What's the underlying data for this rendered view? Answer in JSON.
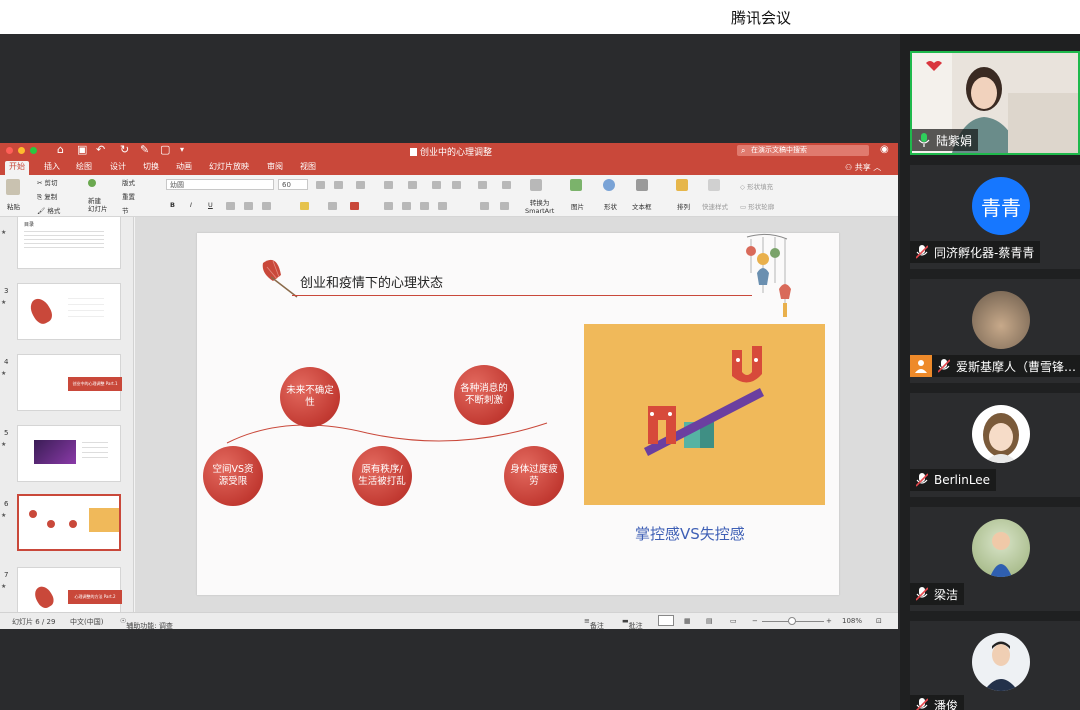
{
  "meeting": {
    "title": "腾讯会议"
  },
  "ppt": {
    "doc_title": "创业中的心理调整",
    "search_placeholder": "在演示文稿中搜索",
    "share_label": "共享",
    "tabs": [
      "开始",
      "插入",
      "绘图",
      "设计",
      "切换",
      "动画",
      "幻灯片放映",
      "审阅",
      "视图"
    ],
    "active_tab": "开始",
    "ribbon": {
      "paste": "粘贴",
      "cut": "剪切",
      "copy": "复制",
      "format": "格式",
      "new_slide": "新建\n幻灯片",
      "layout": "版式",
      "reset": "重置",
      "section": "节",
      "font_name": "幼圆",
      "font_size": "60",
      "convert_smartart": "转换为\nSmartArt",
      "picture": "图片",
      "shape": "形状",
      "textbox": "文本框",
      "arrange": "排列",
      "quick_styles": "快速样式",
      "shape_fill": "形状填充",
      "shape_outline": "形状轮廓"
    },
    "thumbnails": [
      {
        "num": "",
        "caption": "目录"
      },
      {
        "num": "3",
        "caption": ""
      },
      {
        "num": "4",
        "caption": "创业中的心理调整 Part.1"
      },
      {
        "num": "5",
        "caption": ""
      },
      {
        "num": "6",
        "caption": ""
      },
      {
        "num": "7",
        "caption": "心理调整的方法 Part.2"
      }
    ],
    "slide": {
      "title": "创业和疫情下的心理状态",
      "circles": [
        "未来不确定性",
        "各种消息的不断刺激",
        "空间VS资源受限",
        "原有秩序/生活被打乱",
        "身体过度疲劳"
      ],
      "caption": "掌控感VS失控感"
    },
    "status": {
      "slide_counter": "幻灯片 6 / 29",
      "language": "中文(中国)",
      "accessibility": "辅助功能: 调查",
      "notes": "备注",
      "comments": "批注",
      "zoom": "108%"
    }
  },
  "participants": [
    {
      "name": "陆紫娟",
      "mic": "on",
      "avatar": "video"
    },
    {
      "name": "同济孵化器-蔡青青",
      "mic": "muted",
      "avatar": "text",
      "avatar_text": "青青",
      "avatar_color": "#1677ff"
    },
    {
      "name": "爱斯基摩人（曹雪锋…",
      "mic": "muted",
      "avatar": "photo",
      "host": true
    },
    {
      "name": "BerlinLee",
      "mic": "muted",
      "avatar": "photo"
    },
    {
      "name": "梁洁",
      "mic": "muted",
      "avatar": "photo"
    },
    {
      "name": "潘俊",
      "mic": "muted",
      "avatar": "photo"
    }
  ]
}
